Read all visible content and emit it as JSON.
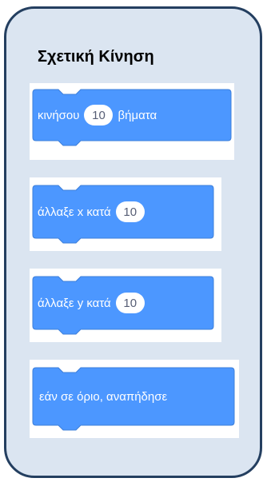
{
  "title": "Σχετική Κίνηση",
  "blocks": [
    {
      "name": "move-steps-block",
      "before": "κινήσου",
      "value": "10",
      "after": "βήματα"
    },
    {
      "name": "change-x-by-block",
      "before": "άλλαξε x κατά",
      "value": "10"
    },
    {
      "name": "change-y-by-block",
      "before": "άλλαξε y κατά",
      "value": "10"
    },
    {
      "name": "if-on-edge-bounce-block",
      "before": "εάν σε όριο, αναπήδησε"
    }
  ],
  "colors": {
    "card_background": "#dbe5f1",
    "card_border": "#243f60",
    "block_fill": "#4c97ff",
    "block_stroke": "#3d7fd9",
    "pill_text": "#575e75"
  }
}
